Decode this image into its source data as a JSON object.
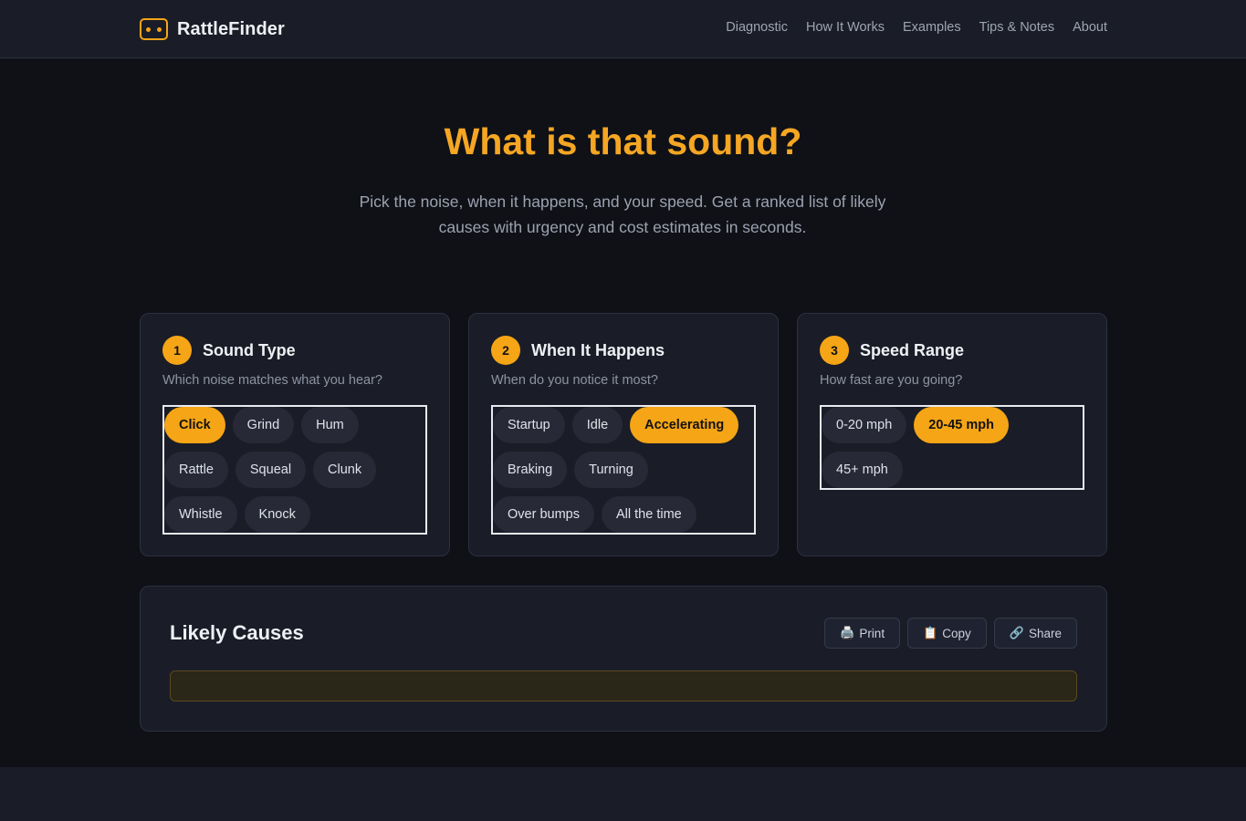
{
  "brand": {
    "name": "RattleFinder",
    "accent": "#f5a516"
  },
  "nav": [
    "Diagnostic",
    "How It Works",
    "Examples",
    "Tips & Notes",
    "About"
  ],
  "hero": {
    "title": "What is that sound?",
    "subtitle": "Pick the noise, when it happens, and your speed. Get a ranked list of likely causes with urgency and cost estimates in seconds."
  },
  "steps": [
    {
      "number": "1",
      "title": "Sound Type",
      "description": "Which noise matches what you hear?",
      "options": [
        "Click",
        "Grind",
        "Hum",
        "Rattle",
        "Squeal",
        "Clunk",
        "Whistle",
        "Knock"
      ],
      "selected": "Click"
    },
    {
      "number": "2",
      "title": "When It Happens",
      "description": "When do you notice it most?",
      "options": [
        "Startup",
        "Idle",
        "Accelerating",
        "Braking",
        "Turning",
        "Over bumps",
        "All the time"
      ],
      "selected": "Accelerating"
    },
    {
      "number": "3",
      "title": "Speed Range",
      "description": "How fast are you going?",
      "options": [
        "0-20 mph",
        "20-45 mph",
        "45+ mph"
      ],
      "selected": "20-45 mph"
    }
  ],
  "results": {
    "title": "Likely Causes",
    "actions": [
      {
        "label": "Print",
        "icon": "printer-icon",
        "glyph": "🖨️"
      },
      {
        "label": "Copy",
        "icon": "clipboard-icon",
        "glyph": "📋"
      },
      {
        "label": "Share",
        "icon": "link-icon",
        "glyph": "🔗"
      }
    ]
  }
}
